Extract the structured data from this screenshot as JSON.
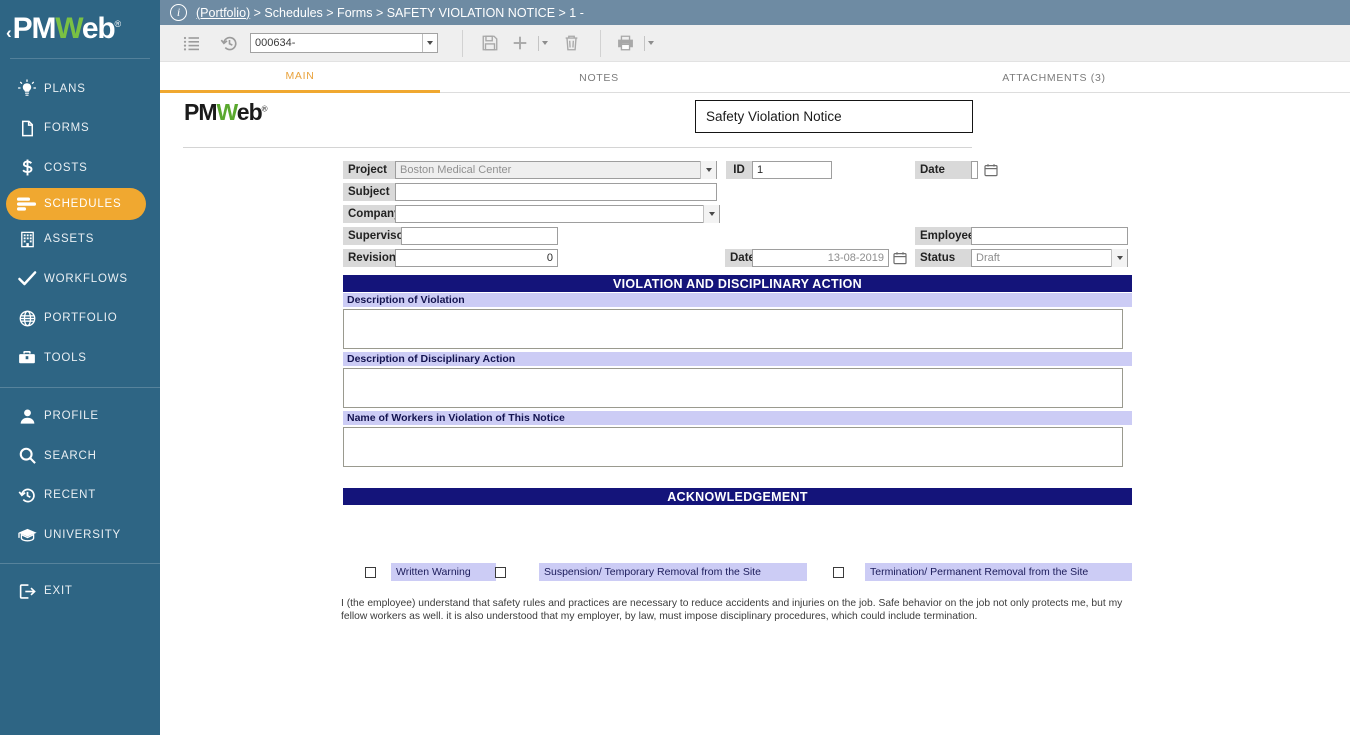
{
  "app": {
    "logo_prefix": "PM",
    "logo_mid": "W",
    "logo_suffix": "eb",
    "logo_reg": "®",
    "chevron": "‹"
  },
  "header": {
    "info_icon": "info-icon",
    "breadcrumb_link": "(Portfolio)",
    "breadcrumb_rest": " > Schedules > Forms > SAFETY VIOLATION NOTICE > 1 -"
  },
  "toolbar": {
    "list_icon": "list-icon",
    "history_icon": "history-icon",
    "record_value": "000634-",
    "save_icon": "save-icon",
    "add_icon": "add-icon",
    "delete_icon": "delete-icon",
    "print_icon": "print-icon"
  },
  "tabs": [
    {
      "label": "MAIN",
      "active": true
    },
    {
      "label": "NOTES",
      "active": false
    },
    {
      "label": "ATTACHMENTS (3)",
      "active": false
    }
  ],
  "sidebar": {
    "items": [
      {
        "label": "PLANS",
        "icon": "lightbulb-icon",
        "active": false
      },
      {
        "label": "FORMS",
        "icon": "document-icon",
        "active": false
      },
      {
        "label": "COSTS",
        "icon": "dollar-icon",
        "active": false
      },
      {
        "label": "SCHEDULES",
        "icon": "schedule-bars-icon",
        "active": true
      },
      {
        "label": "ASSETS",
        "icon": "building-icon",
        "active": false
      },
      {
        "label": "WORKFLOWS",
        "icon": "checkmark-icon",
        "active": false
      },
      {
        "label": "PORTFOLIO",
        "icon": "globe-icon",
        "active": false
      },
      {
        "label": "TOOLS",
        "icon": "toolbox-icon",
        "active": false
      },
      {
        "label": "PROFILE",
        "icon": "person-icon",
        "active": false
      },
      {
        "label": "SEARCH",
        "icon": "search-icon",
        "active": false
      },
      {
        "label": "RECENT",
        "icon": "clock-history-icon",
        "active": false
      },
      {
        "label": "UNIVERSITY",
        "icon": "graduation-cap-icon",
        "active": false
      },
      {
        "label": "EXIT",
        "icon": "exit-icon",
        "active": false
      }
    ]
  },
  "form": {
    "brand_prefix": "PM",
    "brand_mid": "W",
    "brand_suffix": "eb",
    "brand_reg": "®",
    "title": "Safety Violation Notice",
    "fields": {
      "project_label": "Project",
      "project_value": "Boston Medical Center",
      "id_label": "ID",
      "id_value": "1",
      "date_top_label": "Date",
      "date_top_value": "",
      "subject_label": "Subject",
      "subject_value": "",
      "company_label": "Company",
      "company_value": "",
      "supervisor_label": "Supervisor",
      "supervisor_value": "",
      "employee_label": "Employee",
      "employee_value": "",
      "revision_label": "Revision",
      "revision_value": "0",
      "date_label": "Date",
      "date_value": "13-08-2019",
      "status_label": "Status",
      "status_value": "Draft"
    },
    "sections": {
      "violation_header": "VIOLATION AND DISCIPLINARY ACTION",
      "desc_violation_label": "Description of Violation",
      "desc_violation_value": "",
      "desc_action_label": "Description of Disciplinary Action",
      "desc_action_value": "",
      "workers_label": "Name of Workers in Violation of This Notice",
      "workers_value": "",
      "acknowledgement_header": "ACKNOWLEDGEMENT",
      "acknowledgement_text": "I (the employee) understand that safety rules and practices are necessary to reduce accidents and injuries on the job. Safe behavior on the job not only protects me, but my fellow workers as well. it is also understood that my employer, by law, must impose disciplinary procedures, which could include termination."
    },
    "checkboxes": [
      {
        "label": "Written Warning",
        "checked": false
      },
      {
        "label": "Suspension/ Temporary Removal from the Site",
        "checked": false
      },
      {
        "label": "Termination/ Permanent Removal from the Site",
        "checked": false
      }
    ]
  },
  "colors": {
    "sidebar_bg": "#2e6584",
    "header_bg": "#6e8ba3",
    "accent": "#f0a830",
    "band_dark": "#14147a",
    "band_light": "#ccccf5",
    "brand_green": "#7ac143"
  }
}
